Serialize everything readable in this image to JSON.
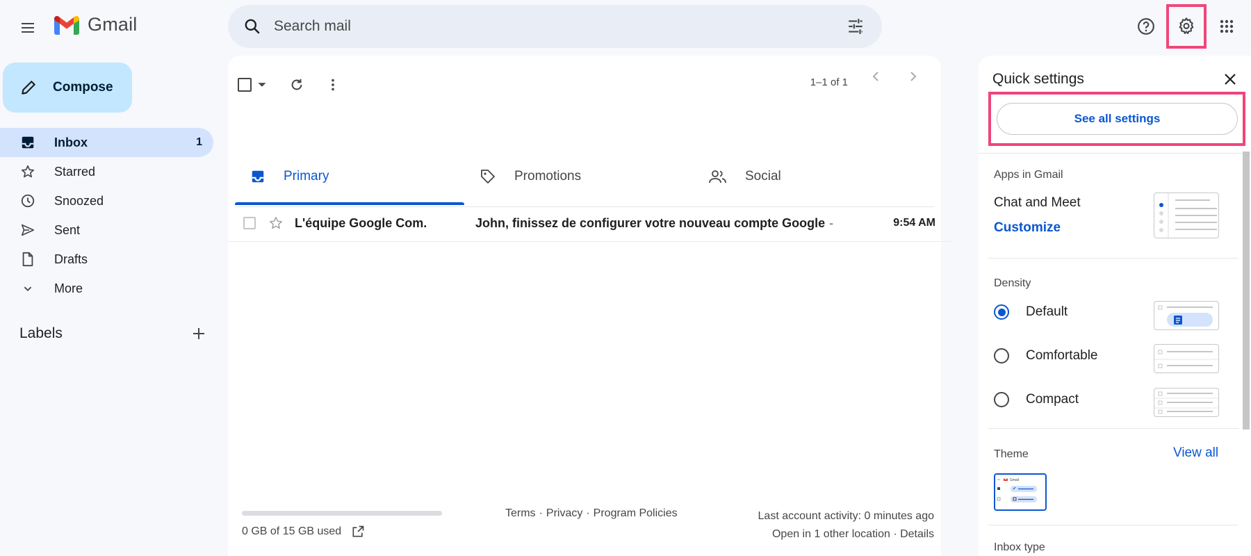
{
  "header": {
    "app_name": "Gmail",
    "search_placeholder": "Search mail"
  },
  "sidebar": {
    "compose_label": "Compose",
    "items": [
      {
        "label": "Inbox",
        "count": "1",
        "icon": "inbox-icon"
      },
      {
        "label": "Starred",
        "icon": "star-icon"
      },
      {
        "label": "Snoozed",
        "icon": "clock-icon"
      },
      {
        "label": "Sent",
        "icon": "send-icon"
      },
      {
        "label": "Drafts",
        "icon": "draft-icon"
      },
      {
        "label": "More",
        "icon": "chevron-down-icon"
      }
    ],
    "labels_title": "Labels"
  },
  "main": {
    "pager": "1–1 of 1",
    "tabs": [
      {
        "label": "Primary"
      },
      {
        "label": "Promotions"
      },
      {
        "label": "Social"
      }
    ],
    "email": {
      "sender": "L'équipe Google Com.",
      "subject": "John, finissez de configurer votre nouveau compte Google",
      "separator": "-",
      "time": "9:54 AM"
    },
    "storage": {
      "text": "0 GB of 15 GB used",
      "used_fraction": 0.0
    },
    "footer": {
      "terms": "Terms",
      "privacy": "Privacy",
      "program_policies": "Program Policies",
      "sep": "·",
      "last_activity": "Last account activity: 0 minutes ago",
      "open_locations": "Open in 1 other location",
      "details": "Details"
    }
  },
  "quick_settings": {
    "title": "Quick settings",
    "see_all": "See all settings",
    "apps_title": "Apps in Gmail",
    "chat_meet": "Chat and Meet",
    "customize": "Customize",
    "density_title": "Density",
    "density_options": [
      {
        "label": "Default",
        "selected": true
      },
      {
        "label": "Comfortable",
        "selected": false
      },
      {
        "label": "Compact",
        "selected": false
      }
    ],
    "theme_title": "Theme",
    "view_all": "View all",
    "theme_thumb_text": "Gmail",
    "inbox_type_title": "Inbox type"
  },
  "colors": {
    "accent": "#0b57d0",
    "highlight": "#f0467a",
    "compose_bg": "#c2e7ff",
    "active_nav": "#d3e3fd"
  }
}
